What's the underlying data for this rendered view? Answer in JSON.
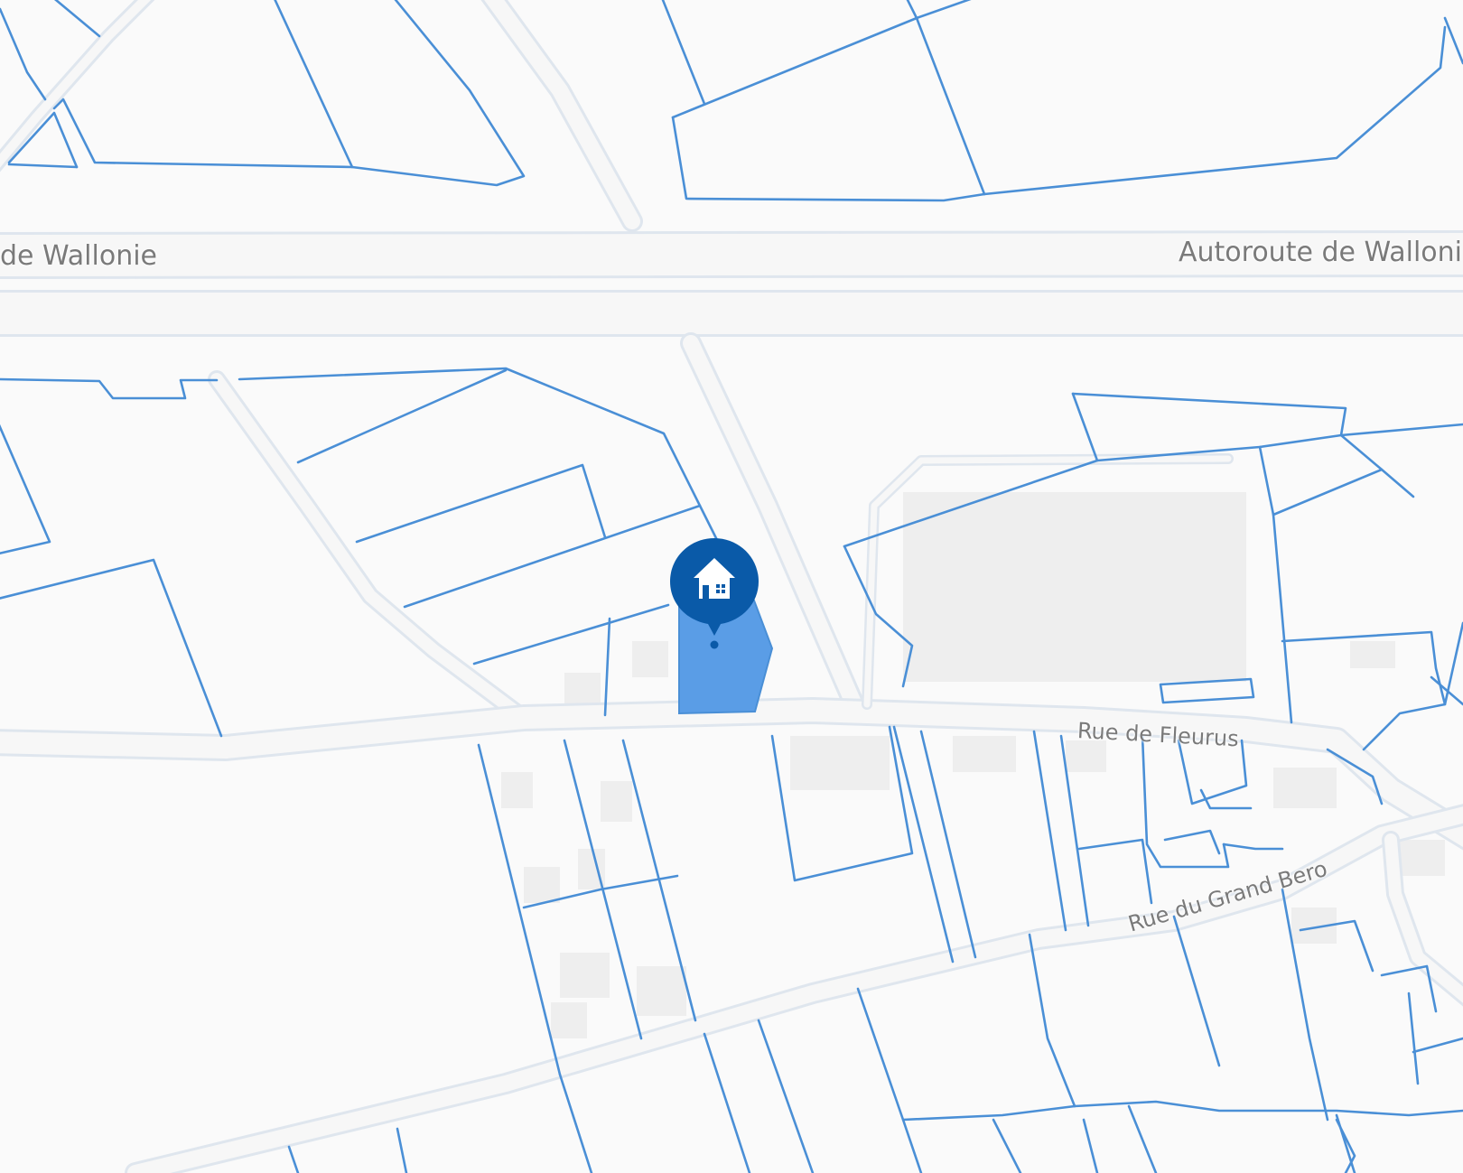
{
  "map": {
    "road_labels": {
      "motorway_left": "de Wallonie",
      "motorway_right": "Autoroute de Walloni",
      "rue_de_fleurus": "Rue de Fleurus",
      "rue_du_grand_bero": "Rue du Grand Bero"
    },
    "colors": {
      "parcel_outline": "#4a8fd6",
      "selected_parcel": "#5a9de6",
      "marker": "#0a5aa8",
      "background": "#fafafa",
      "road": "#f7f7f7",
      "building": "#eeeeee"
    },
    "marker": {
      "icon": "house-icon"
    }
  }
}
